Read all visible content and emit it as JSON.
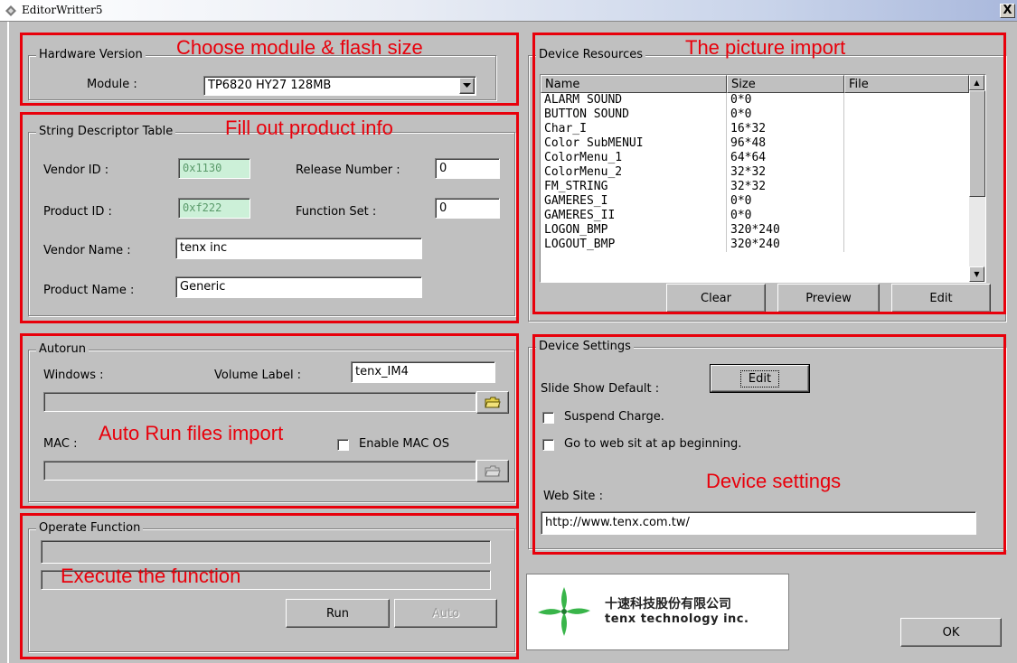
{
  "window": {
    "title": "EditorWritter5",
    "close_label": "X"
  },
  "hardware": {
    "group_label": "Hardware Version",
    "module_label": "Module :",
    "module_value": "TP6820 HY27 128MB"
  },
  "strings": {
    "group_label": "String Descriptor Table",
    "vendor_id_label": "Vendor ID :",
    "vendor_id_value": "0x1130",
    "release_label": "Release Number :",
    "release_value": "0",
    "product_id_label": "Product ID :",
    "product_id_value": "0xf222",
    "function_label": "Function Set :",
    "function_value": "0",
    "vendor_name_label": "Vendor Name :",
    "vendor_name_value": "tenx inc",
    "product_name_label": "Product Name :",
    "product_name_value": "Generic"
  },
  "autorun": {
    "group_label": "Autorun",
    "windows_label": "Windows :",
    "volume_label": "Volume Label :",
    "volume_value": "tenx_IM4",
    "mac_label": "MAC :",
    "enable_mac_label": "Enable MAC OS"
  },
  "operate": {
    "group_label": "Operate Function",
    "run_label": "Run",
    "auto_label": "Auto"
  },
  "resources": {
    "group_label": "Device Resources",
    "columns": [
      "Name",
      "Size",
      "File"
    ],
    "rows": [
      {
        "name": "ALARM SOUND",
        "size": "0*0",
        "file": ""
      },
      {
        "name": "BUTTON SOUND",
        "size": "0*0",
        "file": ""
      },
      {
        "name": "Char_I",
        "size": "16*32",
        "file": ""
      },
      {
        "name": "Color SubMENUI",
        "size": "96*48",
        "file": ""
      },
      {
        "name": "ColorMenu_1",
        "size": "64*64",
        "file": ""
      },
      {
        "name": "ColorMenu_2",
        "size": "32*32",
        "file": ""
      },
      {
        "name": "FM_STRING",
        "size": "32*32",
        "file": ""
      },
      {
        "name": "GAMERES_I",
        "size": "0*0",
        "file": ""
      },
      {
        "name": "GAMERES_II",
        "size": "0*0",
        "file": ""
      },
      {
        "name": "LOGON_BMP",
        "size": "320*240",
        "file": ""
      },
      {
        "name": "LOGOUT_BMP",
        "size": "320*240",
        "file": ""
      }
    ],
    "clear_label": "Clear",
    "preview_label": "Preview",
    "edit_label": "Edit"
  },
  "settings": {
    "group_label": "Device Settings",
    "slideshow_label": "Slide Show Default :",
    "edit_label": "Edit",
    "suspend_label": "Suspend Charge.",
    "goto_label": "Go to web sit at ap beginning.",
    "website_label": "Web Site :",
    "website_value": "http://www.tenx.com.tw/"
  },
  "logo": {
    "chinese": "十速科技股份有限公司",
    "english": "tenx technology inc."
  },
  "ok_label": "OK",
  "annotations": {
    "hardware": "Choose module & flash size",
    "strings": "Fill out product info",
    "autorun": "Auto Run files import",
    "operate": "Execute the function",
    "resources": "The picture import",
    "settings": "Device settings"
  },
  "colors": {
    "annotation": "#e8000b",
    "title_gradient_end": "#a9b8dc",
    "readonly_field": "#ccf0d8",
    "logo_green": "#39b54a"
  },
  "icons": [
    "app-icon",
    "folder-open-icon",
    "dropdown-arrow-icon",
    "scroll-up-icon",
    "scroll-down-icon"
  ]
}
